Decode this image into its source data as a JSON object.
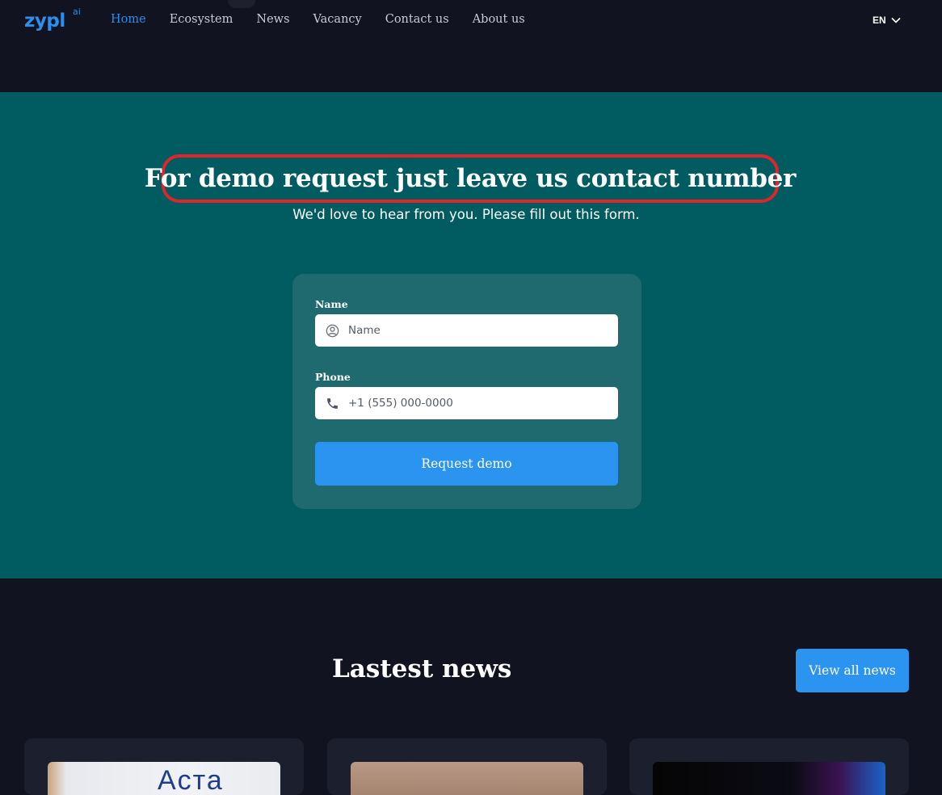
{
  "header": {
    "logo": {
      "text": "zypl",
      "superscript": "ai"
    },
    "nav": [
      {
        "label": "Home",
        "active": true
      },
      {
        "label": "Ecosystem",
        "active": false
      },
      {
        "label": "News",
        "active": false
      },
      {
        "label": "Vacancy",
        "active": false
      },
      {
        "label": "Contact us",
        "active": false
      },
      {
        "label": "About us",
        "active": false
      }
    ],
    "language": {
      "selected": "EN",
      "icon": "chevron-down-icon"
    }
  },
  "demo": {
    "title": "For demo request just leave us contact number",
    "subtitle": "We'd love to hear from you. Please fill out this form.",
    "form": {
      "name_label": "Name",
      "name_placeholder": "Name",
      "name_value": "",
      "name_icon": "user-circle-icon",
      "phone_label": "Phone",
      "phone_placeholder": "+1 (555) 000-0000",
      "phone_value": "",
      "phone_icon": "phone-icon",
      "submit_label": "Request demo"
    }
  },
  "news": {
    "title": "Lastest news",
    "view_all_label": "View all news",
    "cards": [
      {
        "image": "news-image-1"
      },
      {
        "image": "news-image-2"
      },
      {
        "image": "news-image-3"
      }
    ]
  },
  "colors": {
    "accent": "#2b8ff0",
    "page_background": "#111320",
    "demo_background": "#005c61",
    "form_card": "#1e6a6e",
    "highlight_outline": "#e0252a",
    "button": "#2b94f0"
  }
}
